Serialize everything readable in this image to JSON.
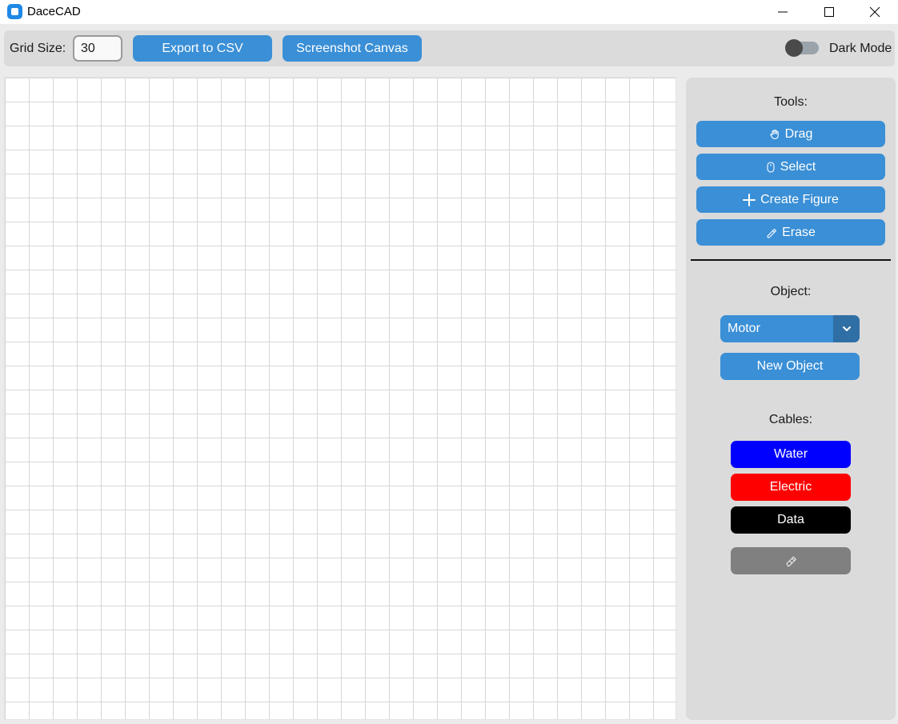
{
  "window": {
    "title": "DaceCAD",
    "app_icon": "app-square-icon",
    "minimize_icon": "minimize-icon",
    "maximize_icon": "maximize-icon",
    "close_icon": "close-icon"
  },
  "toolbar": {
    "grid_size_label": "Grid Size:",
    "grid_size_value": "30",
    "export_label": "Export to CSV",
    "screenshot_label": "Screenshot Canvas",
    "dark_mode_label": "Dark Mode",
    "dark_mode_on": false
  },
  "sidebar": {
    "tools_label": "Tools:",
    "tools": [
      {
        "label": "Drag",
        "icon": "hand-icon"
      },
      {
        "label": "Select",
        "icon": "mouse-icon"
      },
      {
        "label": "Create Figure",
        "icon": "plus-icon"
      },
      {
        "label": "Erase",
        "icon": "eraser-icon"
      }
    ],
    "object_label": "Object:",
    "object_selected": "Motor",
    "new_object_label": "New Object",
    "cables_label": "Cables:",
    "cables": [
      {
        "label": "Water",
        "color": "#0000ff"
      },
      {
        "label": "Electric",
        "color": "#ff0000"
      },
      {
        "label": "Data",
        "color": "#000000"
      }
    ],
    "cable_eraser_icon": "eraser-icon",
    "cable_eraser_color": "#808080"
  },
  "colors": {
    "accent": "#3a8fd6",
    "accent_dark": "#2f6fa6",
    "panel": "#dbdbdb",
    "background": "#ebebeb"
  }
}
